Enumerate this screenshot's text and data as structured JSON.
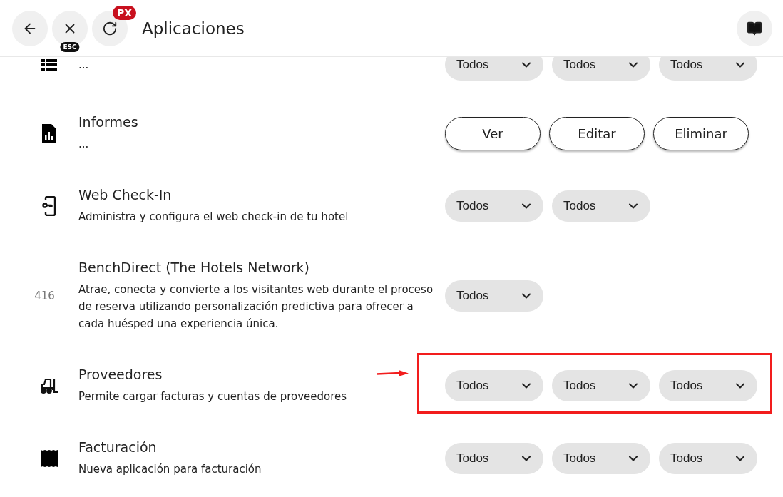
{
  "header": {
    "title": "Aplicaciones",
    "buttons": [
      {
        "kind": "back"
      },
      {
        "kind": "close",
        "badge": "ESC"
      },
      {
        "kind": "reload",
        "badge": "PX"
      }
    ]
  },
  "apps": [
    {
      "description": "...",
      "kind": "selects",
      "selects": [
        "Todos",
        "Todos",
        "Todos"
      ],
      "highlighted": false
    },
    {
      "title": "Informes",
      "description": "...",
      "kind": "buttons",
      "buttons": [
        "Ver",
        "Editar",
        "Eliminar"
      ],
      "highlighted": false
    },
    {
      "title": "Web Check-In",
      "description": "Administra y configura el web check-in de tu hotel",
      "kind": "selects",
      "selects": [
        "Todos",
        "Todos"
      ],
      "highlighted": false
    },
    {
      "number": "416",
      "title": "BenchDirect (The Hotels Network)",
      "description": "Atrae, conecta y convierte a los visitantes web durante el proceso de reserva utilizando personalización predictiva para ofrecer a cada huésped una experiencia única.",
      "kind": "selects",
      "selects": [
        "Todos"
      ],
      "highlighted": false
    },
    {
      "title": "Proveedores",
      "description": "Permite cargar facturas y cuentas de proveedores",
      "kind": "selects",
      "selects": [
        "Todos",
        "Todos",
        "Todos"
      ],
      "highlighted": true
    },
    {
      "title": "Facturación",
      "description": "Nueva aplicación para facturación",
      "kind": "selects",
      "selects": [
        "Todos",
        "Todos",
        "Todos"
      ],
      "highlighted": false
    }
  ]
}
